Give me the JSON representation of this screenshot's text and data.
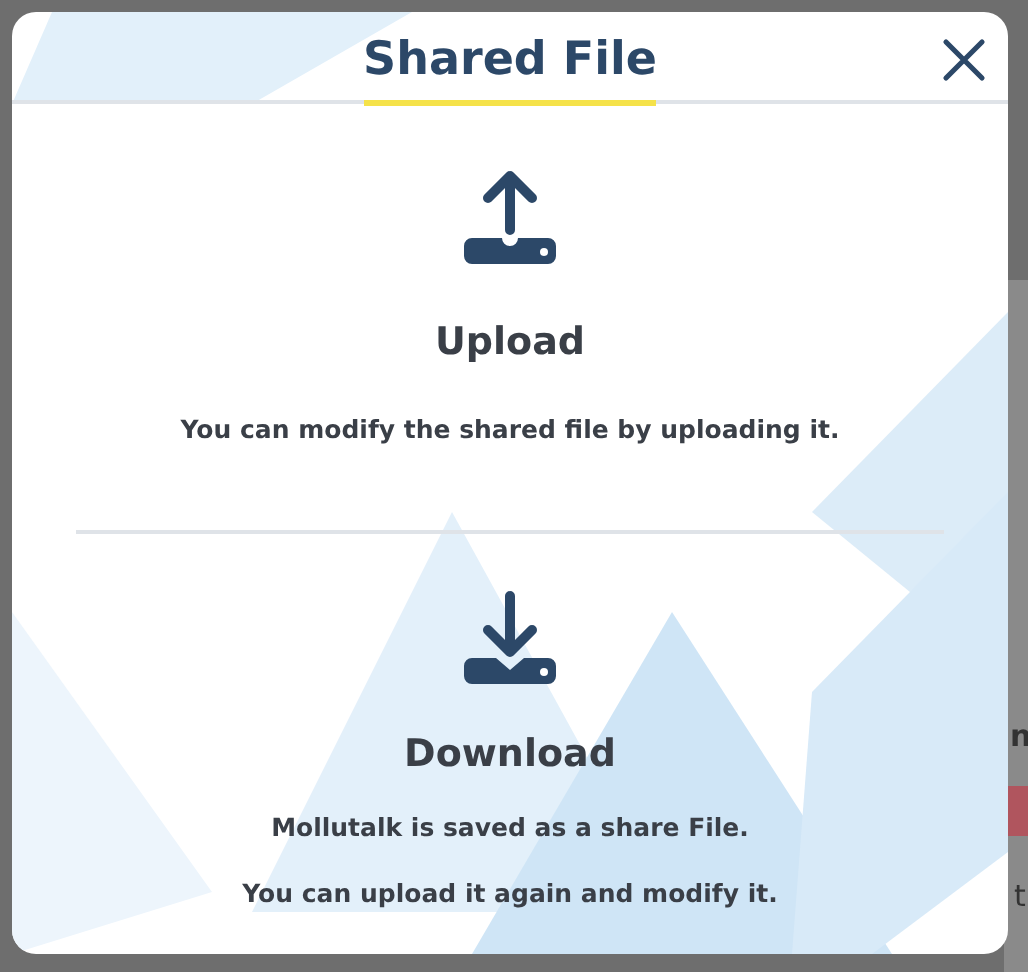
{
  "dialog": {
    "title": "Shared File",
    "sections": [
      {
        "kind": "upload",
        "heading": "Upload",
        "lines": [
          "You can modify the shared file by uploading it."
        ]
      },
      {
        "kind": "download",
        "heading": "Download",
        "lines": [
          "Mollutalk is saved as a share File.",
          "You can upload it again and modify it."
        ]
      }
    ]
  },
  "background_fragments": [
    "n",
    "t"
  ]
}
